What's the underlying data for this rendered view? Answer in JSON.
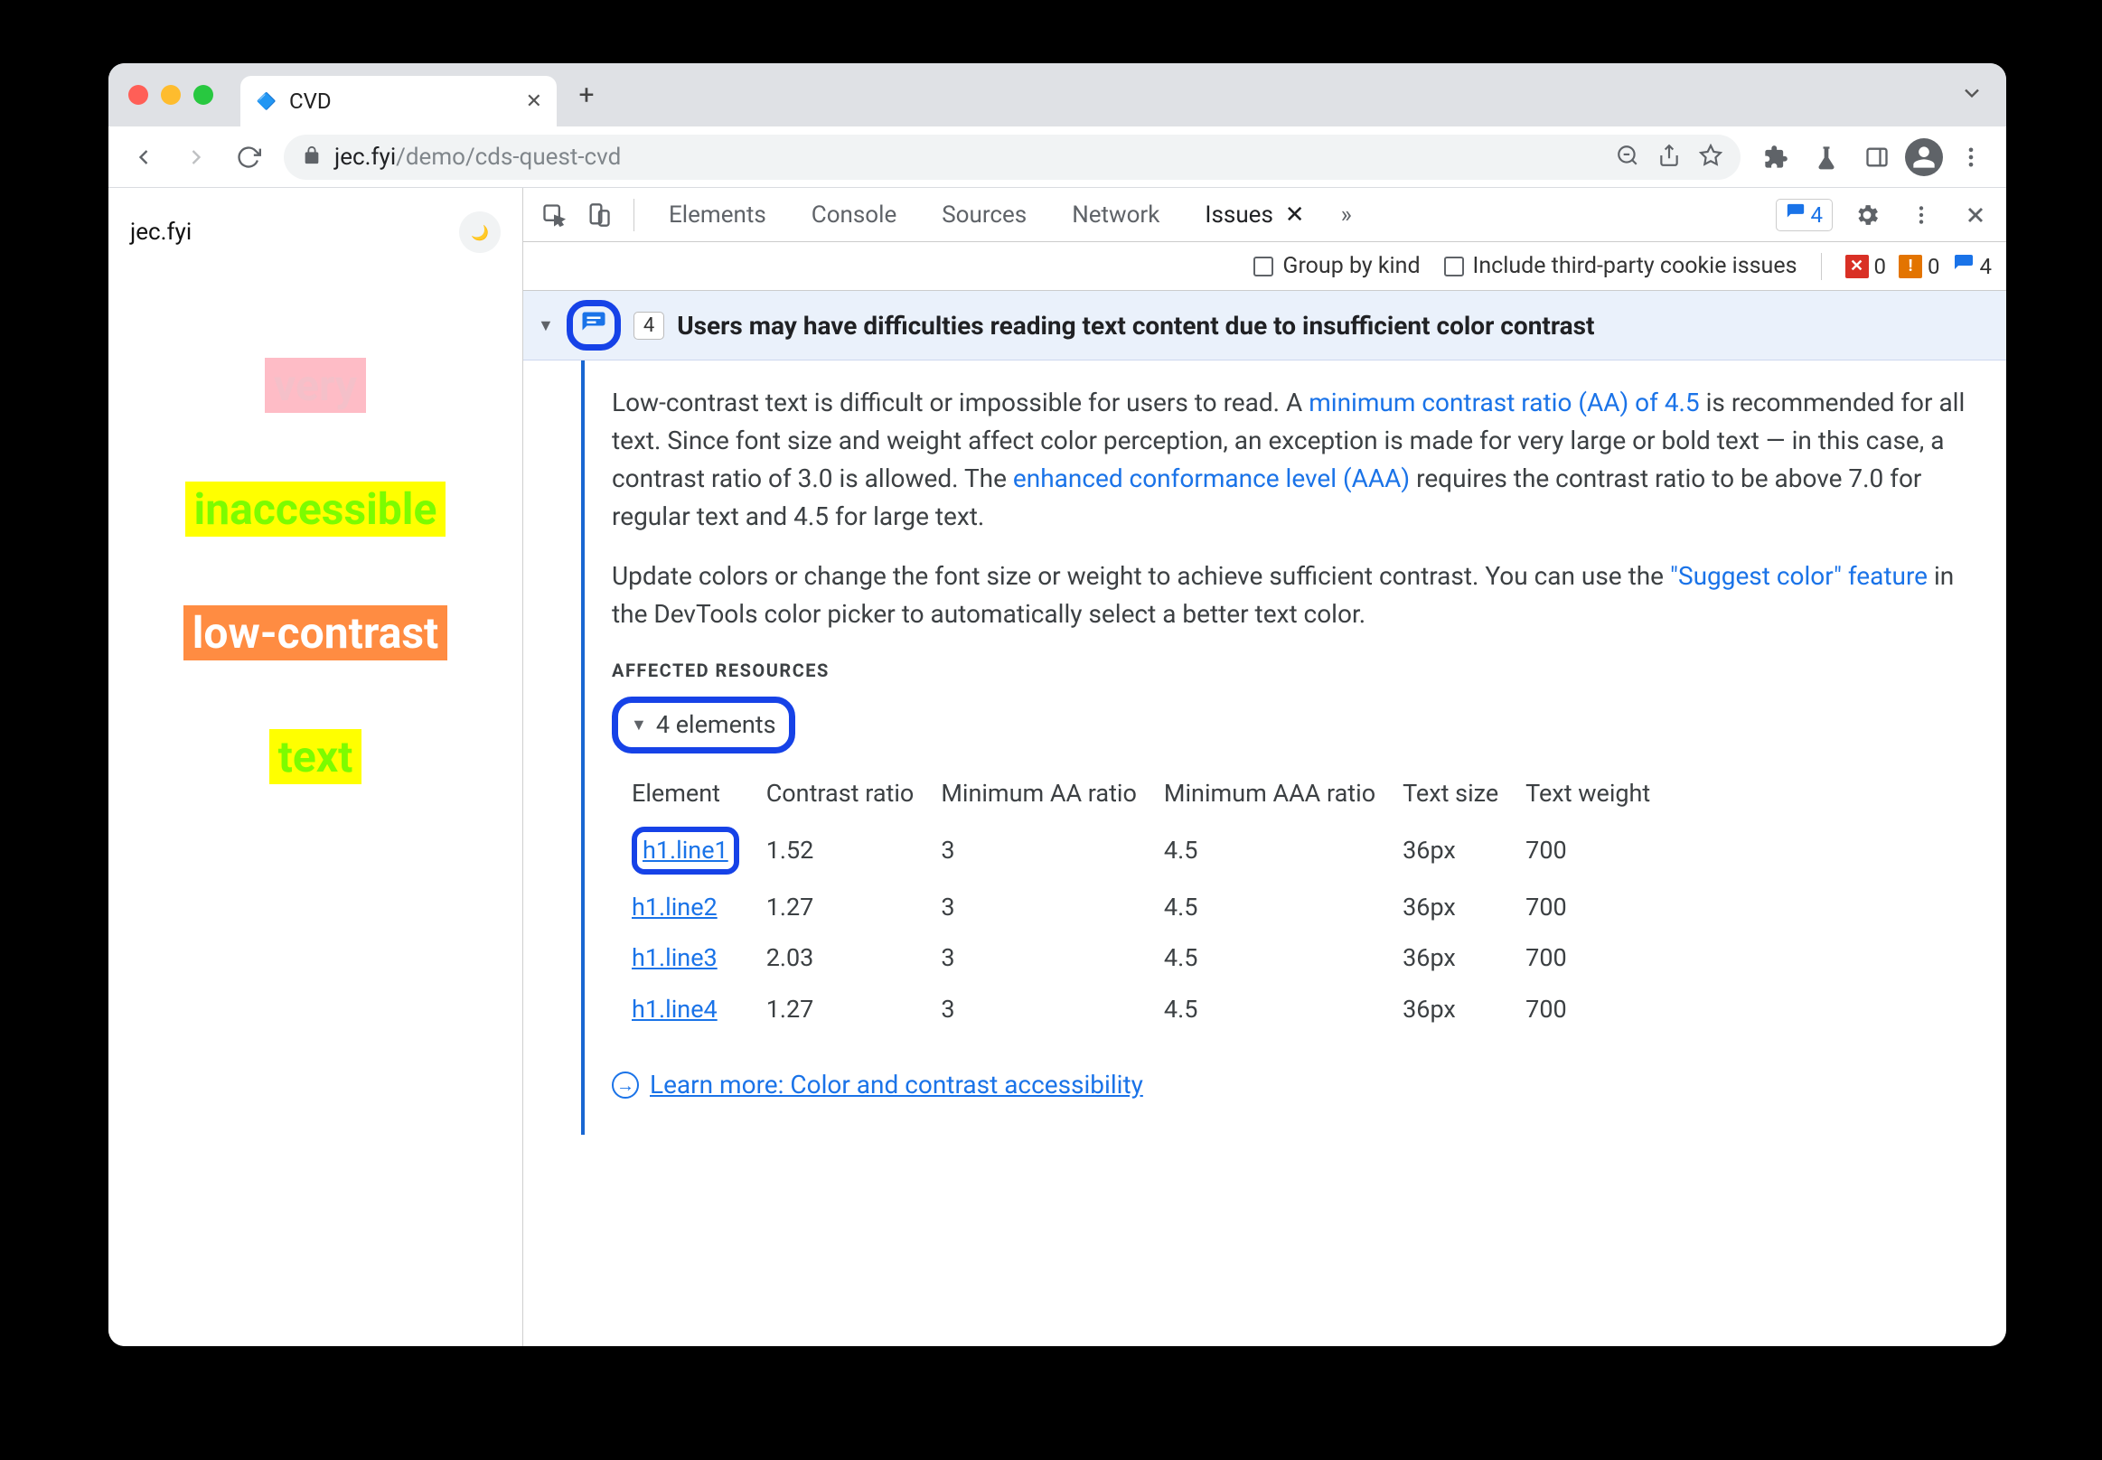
{
  "browser": {
    "tab_title": "CVD",
    "url_host": "jec.fyi",
    "url_path": "/demo/cds-quest-cvd"
  },
  "page": {
    "brand": "jec.fyi",
    "lines": {
      "l1": "very",
      "l2": "inaccessible",
      "l3": "low-contrast",
      "l4": "text"
    }
  },
  "devtools": {
    "tabs": {
      "elements": "Elements",
      "console": "Console",
      "sources": "Sources",
      "network": "Network",
      "issues": "Issues"
    },
    "chip_count": "4",
    "filter": {
      "group": "Group by kind",
      "third": "Include third-party cookie issues"
    },
    "counts": {
      "err": "0",
      "warn": "0",
      "info": "4"
    },
    "issue": {
      "count": "4",
      "title": "Users may have difficulties reading text content due to insufficient color contrast",
      "p1_a": "Low-contrast text is difficult or impossible for users to read. A ",
      "p1_link1": "minimum contrast ratio (AA) of 4.5",
      "p1_b": " is recommended for all text. Since font size and weight affect color perception, an exception is made for very large or bold text — in this case, a contrast ratio of 3.0 is allowed. The ",
      "p1_link2": "enhanced conformance level (AAA)",
      "p1_c": " requires the contrast ratio to be above 7.0 for regular text and 4.5 for large text.",
      "p2_a": "Update colors or change the font size or weight to achieve sufficient contrast. You can use the ",
      "p2_link": "\"Suggest color\" feature",
      "p2_b": " in the DevTools color picker to automatically select a better text color.",
      "affected_label": "AFFECTED RESOURCES",
      "elements_toggle": "4 elements",
      "cols": {
        "el": "Element",
        "cr": "Contrast ratio",
        "aa": "Minimum AA ratio",
        "aaa": "Minimum AAA ratio",
        "size": "Text size",
        "weight": "Text weight"
      },
      "rows": [
        {
          "el": "h1.line1",
          "cr": "1.52",
          "aa": "3",
          "aaa": "4.5",
          "size": "36px",
          "weight": "700"
        },
        {
          "el": "h1.line2",
          "cr": "1.27",
          "aa": "3",
          "aaa": "4.5",
          "size": "36px",
          "weight": "700"
        },
        {
          "el": "h1.line3",
          "cr": "2.03",
          "aa": "3",
          "aaa": "4.5",
          "size": "36px",
          "weight": "700"
        },
        {
          "el": "h1.line4",
          "cr": "1.27",
          "aa": "3",
          "aaa": "4.5",
          "size": "36px",
          "weight": "700"
        }
      ],
      "learn": "Learn more: Color and contrast accessibility"
    }
  }
}
